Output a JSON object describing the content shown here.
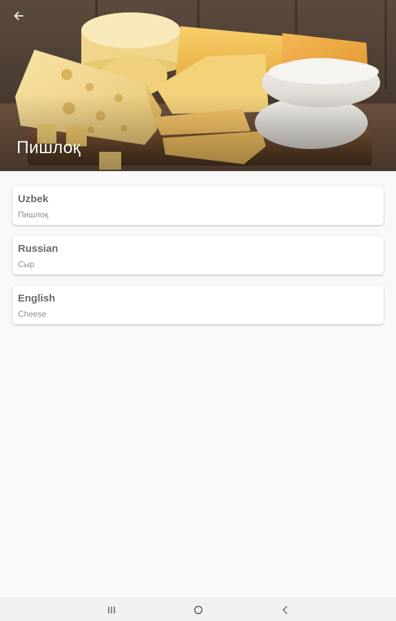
{
  "header": {
    "title": "Пишлоқ",
    "back_icon": "arrow-back-icon"
  },
  "translations": [
    {
      "language": "Uzbek",
      "word": "Пишлоқ"
    },
    {
      "language": "Russian",
      "word": "Сыр"
    },
    {
      "language": "English",
      "word": "Cheese"
    }
  ],
  "navbar": {
    "recents_icon": "recents-icon",
    "home_icon": "home-icon",
    "back_icon": "nav-back-icon"
  },
  "colors": {
    "background": "#f9f9f9",
    "card": "#ffffff",
    "title_text": "#6a6a6a",
    "subtitle_text": "#8c8c8c"
  }
}
